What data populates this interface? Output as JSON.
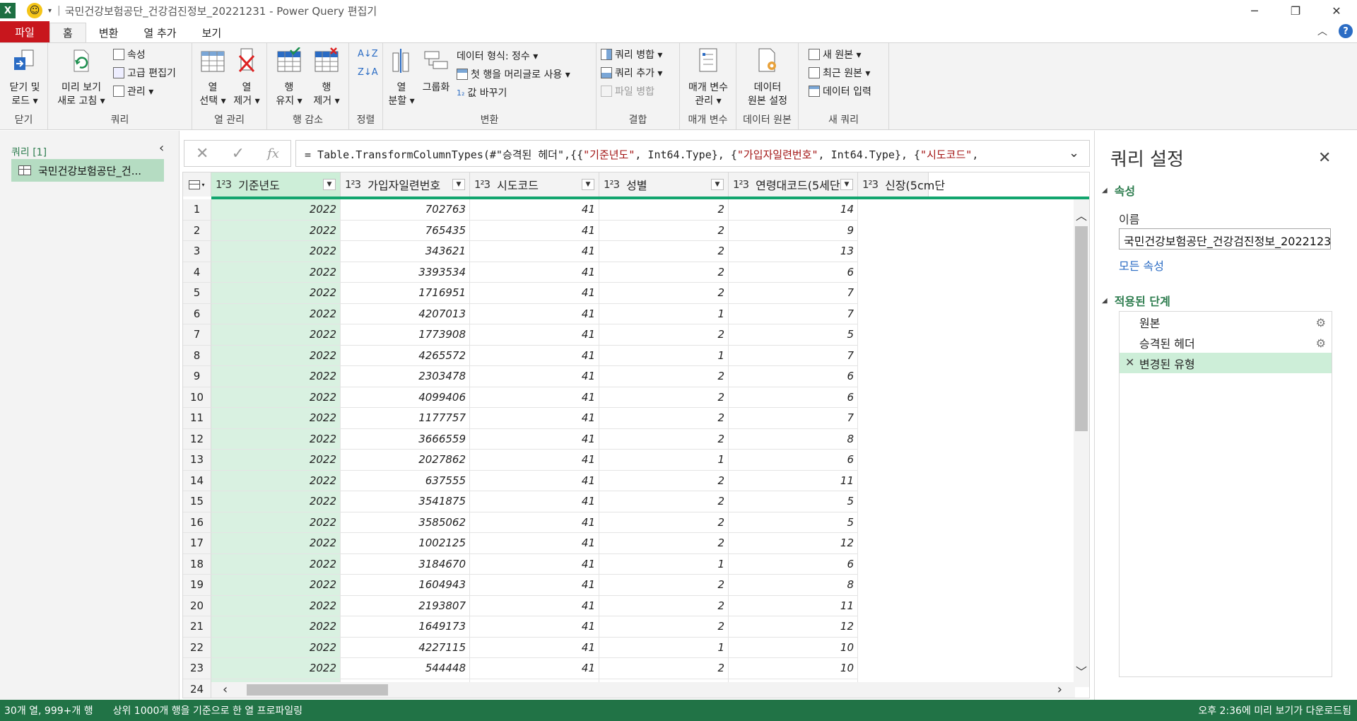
{
  "window": {
    "title": "국민건강보험공단_건강검진정보_20221231 - Power Query 편집기"
  },
  "tabs": [
    {
      "label": "파일"
    },
    {
      "label": "홈"
    },
    {
      "label": "변환"
    },
    {
      "label": "열 추가"
    },
    {
      "label": "보기"
    }
  ],
  "ribbon": {
    "close": {
      "label1": "닫기 및",
      "label2": "로드 ▾",
      "group": "닫기"
    },
    "query": {
      "refresh1": "미리 보기",
      "refresh2": "새로 고침 ▾",
      "properties": "속성",
      "advanced_editor": "고급 편집기",
      "manage": "관리 ▾",
      "group": "쿼리"
    },
    "columns": {
      "choose1": "열",
      "choose2": "선택 ▾",
      "remove1": "열",
      "remove2": "제거 ▾",
      "group": "열 관리"
    },
    "rows": {
      "keep1": "행",
      "keep2": "유지 ▾",
      "remove1": "행",
      "remove2": "제거 ▾",
      "group": "행 감소"
    },
    "sort": {
      "group": "정렬"
    },
    "transform": {
      "split1": "열",
      "split2": "분할 ▾",
      "group_by": "그룹화",
      "data_type": "데이터 형식: 정수 ▾",
      "first_row_header": "첫 행을 머리글로 사용 ▾",
      "replace_values": "값 바꾸기",
      "group": "변환"
    },
    "combine": {
      "merge": "쿼리 병합 ▾",
      "append": "쿼리 추가 ▾",
      "combine_files": "파일 병합",
      "group": "결합"
    },
    "params": {
      "label1": "매개 변수",
      "label2": "관리 ▾",
      "group": "매개 변수"
    },
    "datasource": {
      "label1": "데이터",
      "label2": "원본 설정",
      "group": "데이터 원본"
    },
    "newquery": {
      "new_source": "새 원본 ▾",
      "recent_sources": "최근 원본 ▾",
      "enter_data": "데이터 입력",
      "group": "새 쿼리"
    }
  },
  "queries_pane": {
    "header": "쿼리 [1]",
    "item": "국민건강보험공단_건..."
  },
  "formula": {
    "prefix": "= Table.TransformColumnTypes(#\"승격된 헤더\",{{",
    "s1": "\"기준년도\"",
    "m1": ", Int64.Type}, {",
    "s2": "\"가입자일련번호\"",
    "m2": ", Int64.Type}, {",
    "s3": "\"시도코드\"",
    "m3": ","
  },
  "grid": {
    "columns": [
      {
        "type": "1²3",
        "name": "기준년도"
      },
      {
        "type": "1²3",
        "name": "가입자일련번호"
      },
      {
        "type": "1²3",
        "name": "시도코드"
      },
      {
        "type": "1²3",
        "name": "성별"
      },
      {
        "type": "1²3",
        "name": "연령대코드(5세단..."
      },
      {
        "type": "1²3",
        "name": "신장(5cm단"
      }
    ],
    "rows": [
      [
        "1",
        "2022",
        "702763",
        "41",
        "2",
        "14"
      ],
      [
        "2",
        "2022",
        "765435",
        "41",
        "2",
        "9"
      ],
      [
        "3",
        "2022",
        "343621",
        "41",
        "2",
        "13"
      ],
      [
        "4",
        "2022",
        "3393534",
        "41",
        "2",
        "6"
      ],
      [
        "5",
        "2022",
        "1716951",
        "41",
        "2",
        "7"
      ],
      [
        "6",
        "2022",
        "4207013",
        "41",
        "1",
        "7"
      ],
      [
        "7",
        "2022",
        "1773908",
        "41",
        "2",
        "5"
      ],
      [
        "8",
        "2022",
        "4265572",
        "41",
        "1",
        "7"
      ],
      [
        "9",
        "2022",
        "2303478",
        "41",
        "2",
        "6"
      ],
      [
        "10",
        "2022",
        "4099406",
        "41",
        "2",
        "6"
      ],
      [
        "11",
        "2022",
        "1177757",
        "41",
        "2",
        "7"
      ],
      [
        "12",
        "2022",
        "3666559",
        "41",
        "2",
        "8"
      ],
      [
        "13",
        "2022",
        "2027862",
        "41",
        "1",
        "6"
      ],
      [
        "14",
        "2022",
        "637555",
        "41",
        "2",
        "11"
      ],
      [
        "15",
        "2022",
        "3541875",
        "41",
        "2",
        "5"
      ],
      [
        "16",
        "2022",
        "3585062",
        "41",
        "2",
        "5"
      ],
      [
        "17",
        "2022",
        "1002125",
        "41",
        "2",
        "12"
      ],
      [
        "18",
        "2022",
        "3184670",
        "41",
        "1",
        "6"
      ],
      [
        "19",
        "2022",
        "1604943",
        "41",
        "2",
        "8"
      ],
      [
        "20",
        "2022",
        "2193807",
        "41",
        "2",
        "11"
      ],
      [
        "21",
        "2022",
        "1649173",
        "41",
        "2",
        "12"
      ],
      [
        "22",
        "2022",
        "4227115",
        "41",
        "1",
        "10"
      ],
      [
        "23",
        "2022",
        "544448",
        "41",
        "2",
        "10"
      ],
      [
        "24",
        "",
        "",
        "",
        "",
        ""
      ]
    ]
  },
  "query_settings": {
    "title": "쿼리 설정",
    "properties_header": "속성",
    "name_label": "이름",
    "name_value": "국민건강보험공단_건강검진정보_20221231",
    "all_properties": "모든 속성",
    "steps_header": "적용된 단계",
    "steps": [
      "원본",
      "승격된 헤더",
      "변경된 유형"
    ]
  },
  "status": {
    "columns_rows": "30개 열, 999+개 행",
    "profiling": "상위 1000개 행을 기준으로 한 열 프로파일링",
    "download": "오후 2:36에 미리 보기가 다운로드됨"
  }
}
